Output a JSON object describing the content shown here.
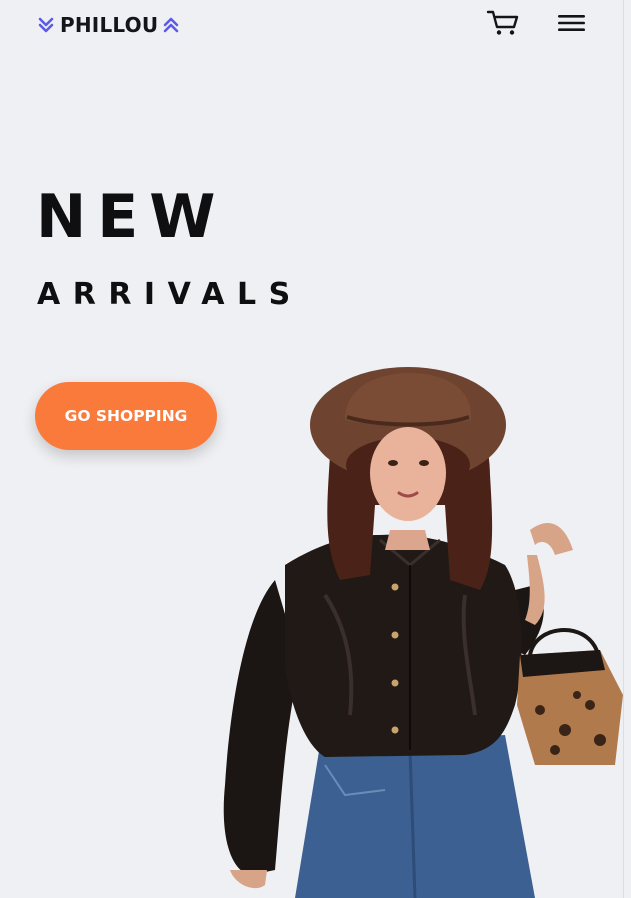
{
  "header": {
    "logo_text": "PHILLOU",
    "accent_color": "#5b5ce6",
    "icons": [
      "chevron-double-down-icon",
      "chevron-double-up-icon",
      "cart-icon",
      "hamburger-menu-icon"
    ]
  },
  "hero": {
    "headline_primary": "NEW",
    "headline_secondary": "ARRIVALS",
    "cta_label": "GO SHOPPING",
    "cta_color": "#fa7a3c",
    "background_color": "#eff0f3"
  }
}
